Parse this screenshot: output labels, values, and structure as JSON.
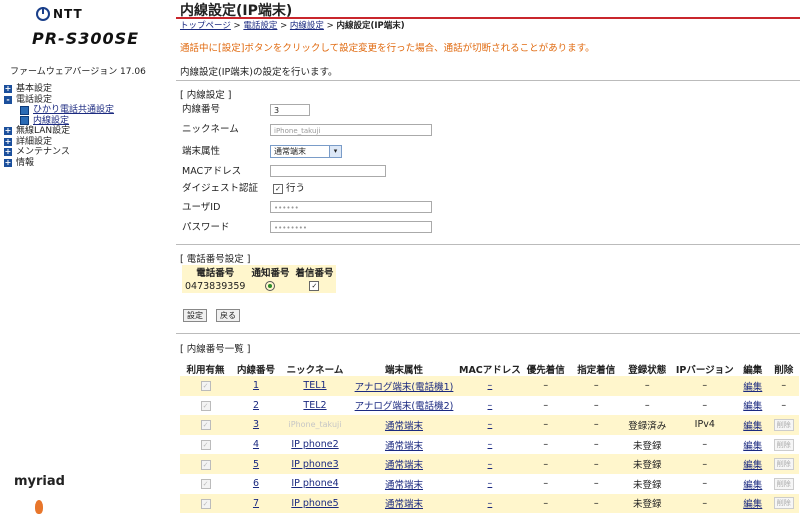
{
  "sidebar": {
    "logo_text": "NTT",
    "model": "PR-S300SE",
    "firmware": "ファームウェアバージョン 17.06",
    "nav": [
      {
        "toggle": "+",
        "label": "基本設定"
      },
      {
        "toggle": "-",
        "label": "電話設定"
      },
      {
        "label": "ひかり電話共通設定",
        "sub": true
      },
      {
        "label": "内線設定",
        "sub": true
      },
      {
        "toggle": "+",
        "label": "無線LAN設定"
      },
      {
        "toggle": "+",
        "label": "詳細設定"
      },
      {
        "toggle": "+",
        "label": "メンテナンス"
      },
      {
        "toggle": "+",
        "label": "情報"
      }
    ],
    "brand": "myriad"
  },
  "header": {
    "title": "内線設定(IP端末)",
    "breadcrumb": [
      "トップページ",
      "電話設定",
      "内線設定"
    ],
    "breadcrumb_current": "内線設定(IP端末)",
    "warning": "通話中に[設定]ボタンをクリックして設定変更を行った場合、通話が切断されることがあります。",
    "description": "内線設定(IP端末)の設定を行います。"
  },
  "form": {
    "section_title": "[ 内線設定 ]",
    "ext_number_label": "内線番号",
    "ext_number_value": "3",
    "nickname_label": "ニックネーム",
    "nickname_value": "iPhone_takuji",
    "terminal_label": "端末属性",
    "terminal_value": "通常端末",
    "terminal_arrow": "▾",
    "mac_label": "MACアドレス",
    "mac_value": "",
    "digest_label": "ダイジェスト認証",
    "digest_check": "✓",
    "digest_option": "行う",
    "userid_label": "ユーザID",
    "userid_value": "••••••",
    "password_label": "パスワード",
    "password_value": "••••••••"
  },
  "phone_section": {
    "title": "[ 電話番号設定 ]",
    "headers": [
      "電話番号",
      "通知番号",
      "着信番号"
    ],
    "number": "0473839359",
    "incoming_check": "✓"
  },
  "buttons": {
    "set": "設定",
    "back": "戻る"
  },
  "list": {
    "title": "[ 内線番号一覧 ]",
    "headers": [
      "利用有無",
      "内線番号",
      "ニックネーム",
      "端末属性",
      "MACアドレス",
      "優先着信",
      "指定着信",
      "登録状態",
      "IPバージョン",
      "編集",
      "削除"
    ],
    "check": "✓",
    "rows": [
      {
        "num": "1",
        "nick": "TEL1",
        "attr": "アナログ端末(電話機1)",
        "mac": "–",
        "pri": "–",
        "spec": "–",
        "state": "–",
        "ipv": "–",
        "edit": "編集",
        "del": "–"
      },
      {
        "num": "2",
        "nick": "TEL2",
        "attr": "アナログ端末(電話機2)",
        "mac": "–",
        "pri": "–",
        "spec": "–",
        "state": "–",
        "ipv": "–",
        "edit": "編集",
        "del": "–"
      },
      {
        "num": "3",
        "nick": "iPhone_takuji",
        "attr": "通常端末",
        "mac": "–",
        "pri": "–",
        "spec": "–",
        "state": "登録済み",
        "ipv": "IPv4",
        "edit": "編集",
        "del": "削除"
      },
      {
        "num": "4",
        "nick": "IP phone2",
        "attr": "通常端末",
        "mac": "–",
        "pri": "–",
        "spec": "–",
        "state": "未登録",
        "ipv": "–",
        "edit": "編集",
        "del": "削除"
      },
      {
        "num": "5",
        "nick": "IP phone3",
        "attr": "通常端末",
        "mac": "–",
        "pri": "–",
        "spec": "–",
        "state": "未登録",
        "ipv": "–",
        "edit": "編集",
        "del": "削除"
      },
      {
        "num": "6",
        "nick": "IP phone4",
        "attr": "通常端末",
        "mac": "–",
        "pri": "–",
        "spec": "–",
        "state": "未登録",
        "ipv": "–",
        "edit": "編集",
        "del": "削除"
      },
      {
        "num": "7",
        "nick": "IP phone5",
        "attr": "通常端末",
        "mac": "–",
        "pri": "–",
        "spec": "–",
        "state": "未登録",
        "ipv": "–",
        "edit": "編集",
        "del": "削除"
      }
    ]
  }
}
